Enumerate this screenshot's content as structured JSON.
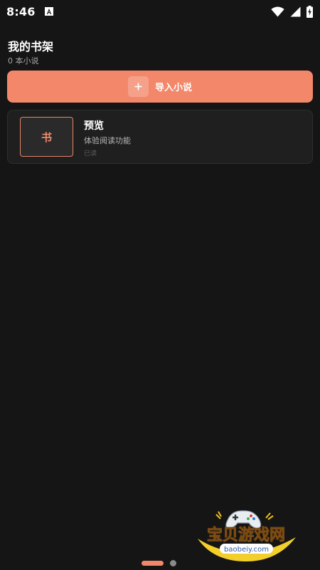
{
  "status_bar": {
    "time": "8:46",
    "icons": [
      "notification-icon",
      "wifi-icon",
      "signal-icon",
      "battery-charging-icon"
    ]
  },
  "header": {
    "title": "我的书架",
    "subtitle": "0 本小说"
  },
  "import_button": {
    "label": "导入小说",
    "icon": "plus-icon"
  },
  "books": [
    {
      "cover_char": "书",
      "title": "预览",
      "description": "体验阅读功能",
      "status": "已读"
    }
  ],
  "watermark": {
    "brand": "宝贝游戏网",
    "domain": "baobeiy.com"
  },
  "page_indicator": {
    "count": 2,
    "active_index": 0
  },
  "colors": {
    "background": "#151515",
    "accent": "#f3876a",
    "card": "#1f1f1f"
  }
}
